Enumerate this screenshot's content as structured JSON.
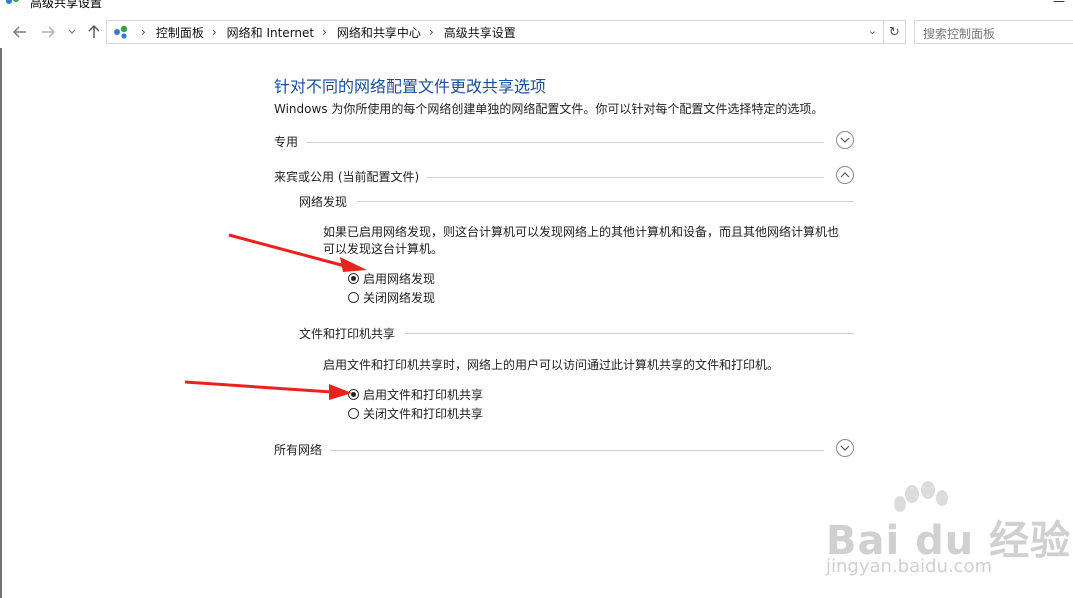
{
  "window": {
    "title": "高级共享设置"
  },
  "address": {
    "breadcrumbs": [
      "控制面板",
      "网络和 Internet",
      "网络和共享中心",
      "高级共享设置"
    ],
    "search_placeholder": "搜索控制面板"
  },
  "content": {
    "heading": "针对不同的网络配置文件更改共享选项",
    "description": "Windows 为你所使用的每个网络创建单独的网络配置文件。你可以针对每个配置文件选择特定的选项。",
    "sections": [
      {
        "label": "专用",
        "expanded": false
      },
      {
        "label": "来宾或公用 (当前配置文件)",
        "expanded": true
      },
      {
        "label": "所有网络",
        "expanded": false
      }
    ],
    "network_discovery": {
      "title": "网络发现",
      "text": "如果已启用网络发现，则这台计算机可以发现网络上的其他计算机和设备，而且其他网络计算机也可以发现这台计算机。",
      "options": [
        {
          "label": "启用网络发现",
          "checked": true
        },
        {
          "label": "关闭网络发现",
          "checked": false
        }
      ]
    },
    "file_printer_sharing": {
      "title": "文件和打印机共享",
      "text": "启用文件和打印机共享时，网络上的用户可以访问通过此计算机共享的文件和打印机。",
      "options": [
        {
          "label": "启用文件和打印机共享",
          "checked": true
        },
        {
          "label": "关闭文件和打印机共享",
          "checked": false
        }
      ]
    }
  },
  "watermark": {
    "logo": "Bai du 经验",
    "url": "jingyan.baidu.com"
  },
  "colors": {
    "heading": "#1a4e9a",
    "arrow": "#e8231d"
  }
}
